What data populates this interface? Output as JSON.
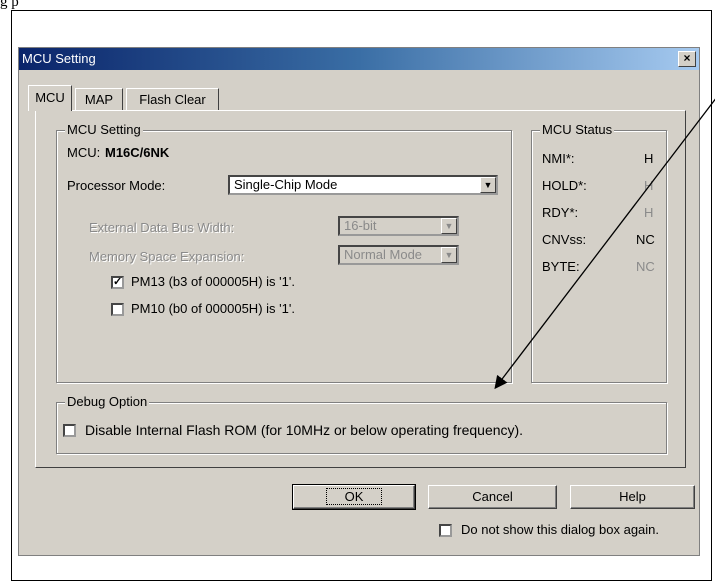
{
  "doc_top_text": "g p",
  "dialog": {
    "title": "MCU Setting",
    "close_glyph": "×",
    "tabs": [
      {
        "label": "MCU"
      },
      {
        "label": "MAP"
      },
      {
        "label": "Flash Clear"
      }
    ],
    "mcu_group": {
      "title": "MCU Setting",
      "mcu_label": "MCU:",
      "mcu_value": "M16C/6NK",
      "processor_mode_label": "Processor Mode:",
      "processor_mode_value": "Single-Chip Mode",
      "external_bus_label": "External Data Bus Width:",
      "external_bus_value": "16-bit",
      "memory_space_label": "Memory Space Expansion:",
      "memory_space_value": "Normal Mode",
      "pm13_label": "PM13 (b3 of 000005H) is '1'.",
      "pm13_checked": true,
      "pm10_label": "PM10 (b0 of 000005H) is '1'.",
      "pm10_checked": false
    },
    "status_group": {
      "title": "MCU Status",
      "rows": [
        {
          "label": "NMI*:",
          "value": "H"
        },
        {
          "label": "HOLD*:",
          "value": "H"
        },
        {
          "label": "RDY*:",
          "value": "H"
        },
        {
          "label": "CNVss:",
          "value": "NC"
        },
        {
          "label": "BYTE:",
          "value": "NC"
        }
      ]
    },
    "debug_group": {
      "title": "Debug Option",
      "disable_flash_label": "Disable Internal Flash ROM (for 10MHz or below operating frequency).",
      "disable_flash_checked": false
    },
    "buttons": {
      "ok": "OK",
      "cancel": "Cancel",
      "help": "Help"
    },
    "dont_show_label": "Do not show this dialog box again.",
    "dont_show_checked": false
  },
  "colors": {
    "dialog_bg": "#d4d0c8",
    "titlebar_start": "#0a246a",
    "titlebar_end": "#a6caf0"
  }
}
